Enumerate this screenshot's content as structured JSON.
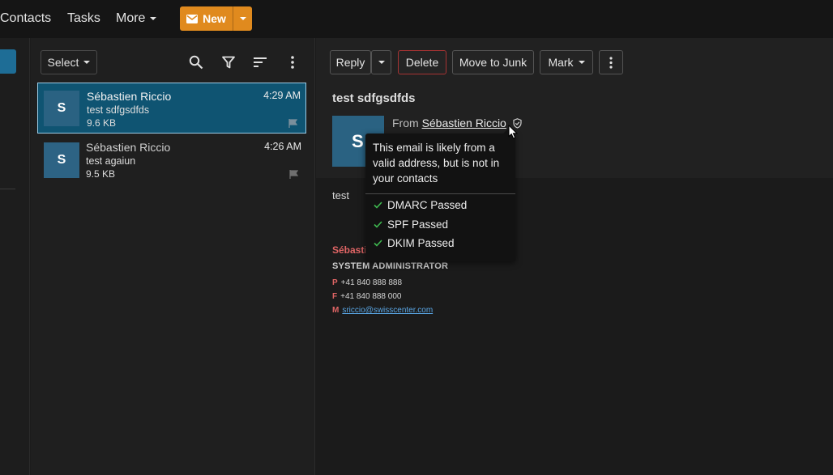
{
  "topbar": {
    "nav": [
      "Contacts",
      "Tasks",
      "More"
    ],
    "new_label": "New",
    "accent_color": "#e08a1e"
  },
  "list": {
    "select_label": "Select",
    "tools": [
      "search-icon",
      "filter-icon",
      "sort-icon",
      "more-vertical-icon"
    ],
    "messages": [
      {
        "initial": "S",
        "sender": "Sébastien Riccio",
        "time": "4:29 AM",
        "subject": "test sdfgsdfds",
        "size": "9.6 KB",
        "selected": true
      },
      {
        "initial": "S",
        "sender": "Sébastien Riccio",
        "time": "4:26 AM",
        "subject": "test agaiun",
        "size": "9.5 KB",
        "selected": false
      }
    ]
  },
  "reader": {
    "toolbar": {
      "reply": "Reply",
      "delete": "Delete",
      "junk": "Move to Junk",
      "mark": "Mark"
    },
    "subject": "test sdfgsdfds",
    "avatar_initial": "S",
    "from_label": "From",
    "from_name": "Sébastien Riccio",
    "body": "test",
    "signature": {
      "name": "Sébasti",
      "title": "SYSTEM ADMINISTRATOR",
      "phone_label": "P",
      "phone": "+41 840 888 888",
      "fax_label": "F",
      "fax": "+41 840 888 000",
      "mail_label": "M",
      "mail": "sriccio@swisscenter.com"
    }
  },
  "tooltip": {
    "message": "This email is likely from a valid address, but is not in your contacts",
    "checks": [
      "DMARC Passed",
      "SPF Passed",
      "DKIM Passed"
    ],
    "check_color": "#3fb950"
  }
}
